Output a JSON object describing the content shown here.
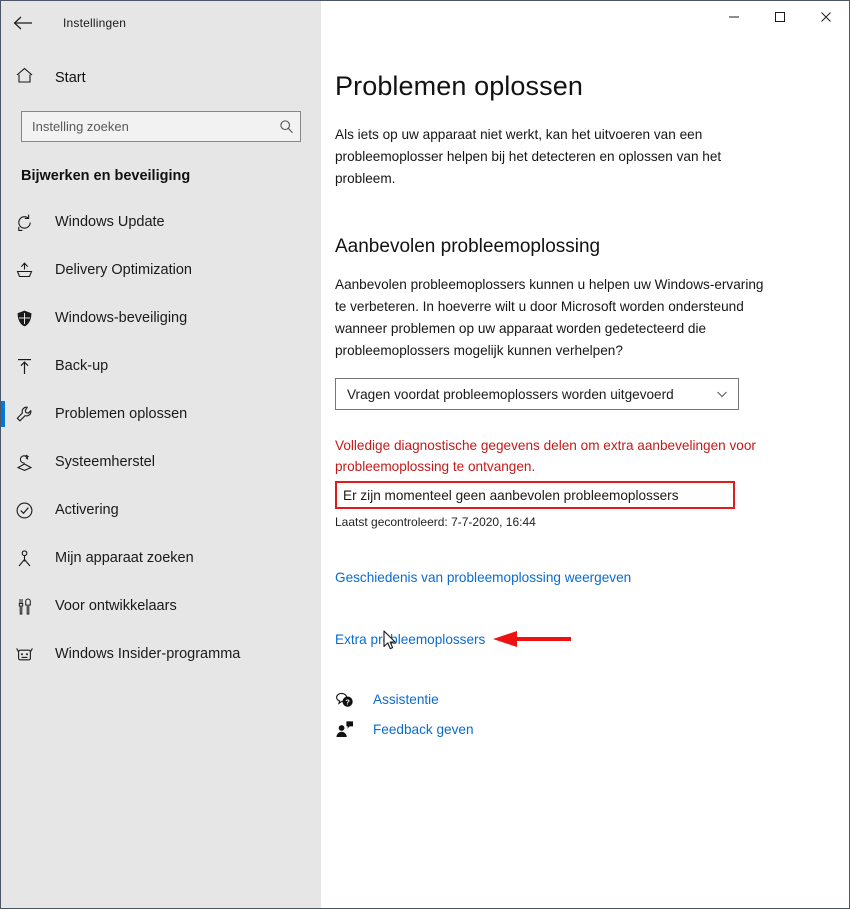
{
  "window": {
    "app_title": "Instellingen",
    "back_icon": "arrow-left-icon",
    "controls": {
      "minimize": "minimize-icon",
      "maximize": "maximize-icon",
      "close": "close-icon"
    }
  },
  "sidebar": {
    "home_label": "Start",
    "home_icon": "home-icon",
    "search": {
      "placeholder": "Instelling zoeken",
      "value": "",
      "icon": "search-icon"
    },
    "category_title": "Bijwerken en beveiliging",
    "items": [
      {
        "label": "Windows Update",
        "icon": "refresh-icon",
        "selected": false
      },
      {
        "label": "Delivery Optimization",
        "icon": "delivery-icon",
        "selected": false
      },
      {
        "label": "Windows-beveiliging",
        "icon": "shield-icon",
        "selected": false
      },
      {
        "label": "Back-up",
        "icon": "backup-upload-icon",
        "selected": false
      },
      {
        "label": "Problemen oplossen",
        "icon": "wrench-icon",
        "selected": true
      },
      {
        "label": "Systeemherstel",
        "icon": "recovery-icon",
        "selected": false
      },
      {
        "label": "Activering",
        "icon": "check-circle-icon",
        "selected": false
      },
      {
        "label": "Mijn apparaat zoeken",
        "icon": "find-device-icon",
        "selected": false
      },
      {
        "label": "Voor ontwikkelaars",
        "icon": "developer-tools-icon",
        "selected": false
      },
      {
        "label": "Windows Insider-programma",
        "icon": "insider-bug-icon",
        "selected": false
      }
    ],
    "accent_color": "#0078d7",
    "background_color": "#e6e6e6"
  },
  "main": {
    "page_title": "Problemen oplossen",
    "intro_text": "Als iets op uw apparaat niet werkt, kan het uitvoeren van een probleemoplosser helpen bij het detecteren en oplossen van het probleem.",
    "section_title": "Aanbevolen probleemoplossing",
    "section_text": "Aanbevolen probleemoplossers kunnen u helpen uw Windows-ervaring te verbeteren. In hoeverre wilt u door Microsoft worden ondersteund wanneer problemen op uw apparaat worden gedetecteerd die probleemoplossers mogelijk kunnen verhelpen?",
    "dropdown": {
      "value": "Vragen voordat probleemoplossers worden uitgevoerd",
      "caret_icon": "chevron-down-icon"
    },
    "diagnostic_warning": "Volledige diagnostische gegevens delen om extra aanbevelingen voor probleemoplossing te ontvangen.",
    "diagnostic_warning_color": "#c41a1a",
    "status_message": "Er zijn momenteel geen aanbevolen probleemoplossers",
    "status_box_color": "#e01b1b",
    "last_checked": "Laatst gecontroleerd: 7-7-2020, 16:44",
    "history_link": "Geschiedenis van probleemoplossing weergeven",
    "extra_link": "Extra probleemoplossers",
    "link_color": "#0a6bd0",
    "annotation": {
      "arrow_icon": "red-arrow-left-icon",
      "arrow_color": "#ee1111",
      "cursor_icon": "mouse-cursor-icon"
    },
    "footer_links": [
      {
        "label": "Assistentie",
        "icon": "help-bubble-icon"
      },
      {
        "label": "Feedback geven",
        "icon": "feedback-person-icon"
      }
    ]
  }
}
